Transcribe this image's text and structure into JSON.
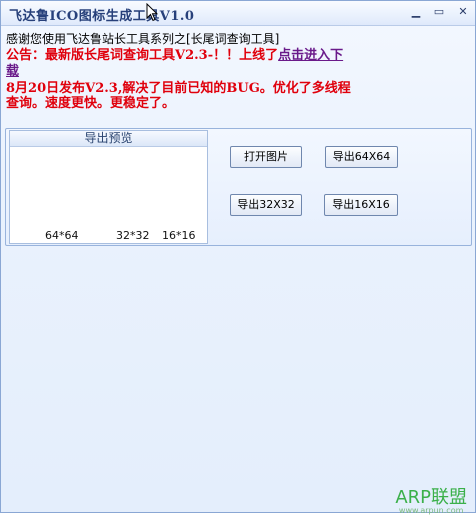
{
  "window": {
    "title": "飞达鲁ICO图标生成工具V1.0",
    "minimize_glyph": "▁",
    "restore_glyph": "▭",
    "close_glyph": "✕"
  },
  "header": {
    "thanks": "感谢您使用飞达鲁站长工具系列之[长尾词查询工具]",
    "notice_prefix": "公告：最新版长尾词查询工具V2.3-！！上线了",
    "notice_link": "点击进入下载",
    "update": "8月20日发布V2.3,解决了目前已知的BUG。优化了多线程查询。速度更快。更稳定了。"
  },
  "preview": {
    "title": "导出预览",
    "sizes": [
      "64*64",
      "32*32",
      "16*16"
    ]
  },
  "buttons": {
    "open_image": "打开图片",
    "export_64": "导出64X64",
    "export_32": "导出32X32",
    "export_16": "导出16X16"
  },
  "watermark": {
    "brand": "ARP联盟",
    "url": "www.arpun.com"
  },
  "colors": {
    "notice_red": "#e0000c",
    "link_purple": "#6a1a8a",
    "title_blue": "#27407a",
    "watermark_green": "#3bb04a"
  }
}
